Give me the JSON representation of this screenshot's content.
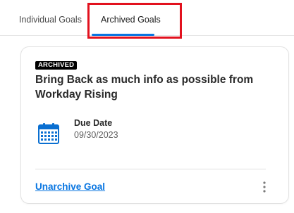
{
  "tabs": [
    {
      "label": "Individual Goals",
      "selected": false
    },
    {
      "label": "Archived Goals",
      "selected": true
    }
  ],
  "card": {
    "badge": "ARCHIVED",
    "title": "Bring Back as much info as possible from Workday Rising",
    "due_label": "Due Date",
    "due_value": "09/30/2023",
    "unarchive_label": "Unarchive Goal",
    "calendar_icon": "calendar-icon",
    "more_icon": "more-vertical-icon"
  },
  "colors": {
    "accent": "#0875e1",
    "highlight": "#e2111e",
    "badge_bg": "#000000"
  }
}
